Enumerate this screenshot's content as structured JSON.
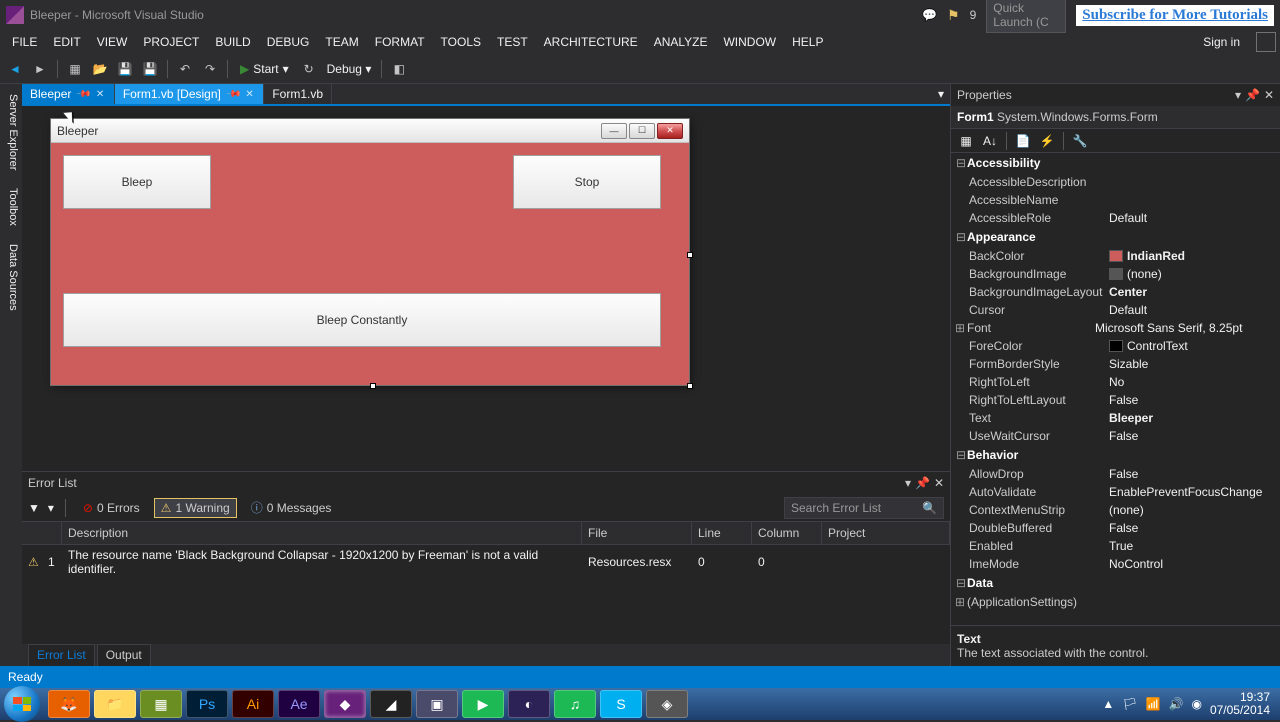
{
  "titlebar": {
    "title": "Bleeper - Microsoft Visual Studio",
    "notif_count": "9",
    "quick_launch_placeholder": "Quick Launch (C",
    "subscribe_link": "Subscribe for More Tutorials"
  },
  "menu": {
    "file": "FILE",
    "edit": "EDIT",
    "view": "VIEW",
    "project": "PROJECT",
    "build": "BUILD",
    "debug": "DEBUG",
    "team": "TEAM",
    "format": "FORMAT",
    "tools": "TOOLS",
    "test": "TEST",
    "architecture": "ARCHITECTURE",
    "analyze": "ANALYZE",
    "window": "WINDOW",
    "help": "HELP",
    "signin": "Sign in"
  },
  "toolbar": {
    "start": "Start",
    "config": "Debug"
  },
  "left_tabs": {
    "server_explorer": "Server Explorer",
    "toolbox": "Toolbox",
    "data_sources": "Data Sources"
  },
  "doc_tabs": [
    {
      "label": "Bleeper"
    },
    {
      "label": "Form1.vb [Design]"
    },
    {
      "label": "Form1.vb"
    }
  ],
  "designer": {
    "form_title": "Bleeper",
    "btn_bleep": "Bleep",
    "btn_stop": "Stop",
    "btn_const": "Bleep Constantly"
  },
  "error_list": {
    "title": "Error List",
    "errors": "0 Errors",
    "warnings": "1 Warning",
    "messages": "0 Messages",
    "search_placeholder": "Search Error List",
    "headers": {
      "desc": "Description",
      "file": "File",
      "line": "Line",
      "col": "Column",
      "proj": "Project"
    },
    "row": {
      "num": "1",
      "desc": "The resource name 'Black Background  Collapsar - 1920x1200 by Freeman' is not a valid identifier.",
      "file": "Resources.resx",
      "line": "0",
      "col": "0"
    },
    "bottom_tabs": {
      "errorlist": "Error List",
      "output": "Output"
    }
  },
  "properties": {
    "title": "Properties",
    "object": {
      "name": "Form1",
      "type": "System.Windows.Forms.Form"
    },
    "cats": {
      "accessibility": "Accessibility",
      "appearance": "Appearance",
      "behavior": "Behavior",
      "data": "Data"
    },
    "rows": {
      "AccessibleDescription": {
        "name": "AccessibleDescription",
        "value": ""
      },
      "AccessibleName": {
        "name": "AccessibleName",
        "value": ""
      },
      "AccessibleRole": {
        "name": "AccessibleRole",
        "value": "Default"
      },
      "BackColor": {
        "name": "BackColor",
        "value": "IndianRed",
        "swatch": "#cd5c5c"
      },
      "BackgroundImage": {
        "name": "BackgroundImage",
        "value": "(none)"
      },
      "BackgroundImageLayout": {
        "name": "BackgroundImageLayout",
        "value": "Center"
      },
      "Cursor": {
        "name": "Cursor",
        "value": "Default"
      },
      "Font": {
        "name": "Font",
        "value": "Microsoft Sans Serif, 8.25pt"
      },
      "ForeColor": {
        "name": "ForeColor",
        "value": "ControlText",
        "swatch": "#000000"
      },
      "FormBorderStyle": {
        "name": "FormBorderStyle",
        "value": "Sizable"
      },
      "RightToLeft": {
        "name": "RightToLeft",
        "value": "No"
      },
      "RightToLeftLayout": {
        "name": "RightToLeftLayout",
        "value": "False"
      },
      "Text": {
        "name": "Text",
        "value": "Bleeper"
      },
      "UseWaitCursor": {
        "name": "UseWaitCursor",
        "value": "False"
      },
      "AllowDrop": {
        "name": "AllowDrop",
        "value": "False"
      },
      "AutoValidate": {
        "name": "AutoValidate",
        "value": "EnablePreventFocusChange"
      },
      "ContextMenuStrip": {
        "name": "ContextMenuStrip",
        "value": "(none)"
      },
      "DoubleBuffered": {
        "name": "DoubleBuffered",
        "value": "False"
      },
      "Enabled": {
        "name": "Enabled",
        "value": "True"
      },
      "ImeMode": {
        "name": "ImeMode",
        "value": "NoControl"
      },
      "ApplicationSettings": {
        "name": "(ApplicationSettings)",
        "value": ""
      }
    },
    "desc": {
      "name": "Text",
      "text": "The text associated with the control."
    }
  },
  "status": {
    "text": "Ready"
  },
  "taskbar": {
    "time": "19:37",
    "date": "07/05/2014"
  }
}
